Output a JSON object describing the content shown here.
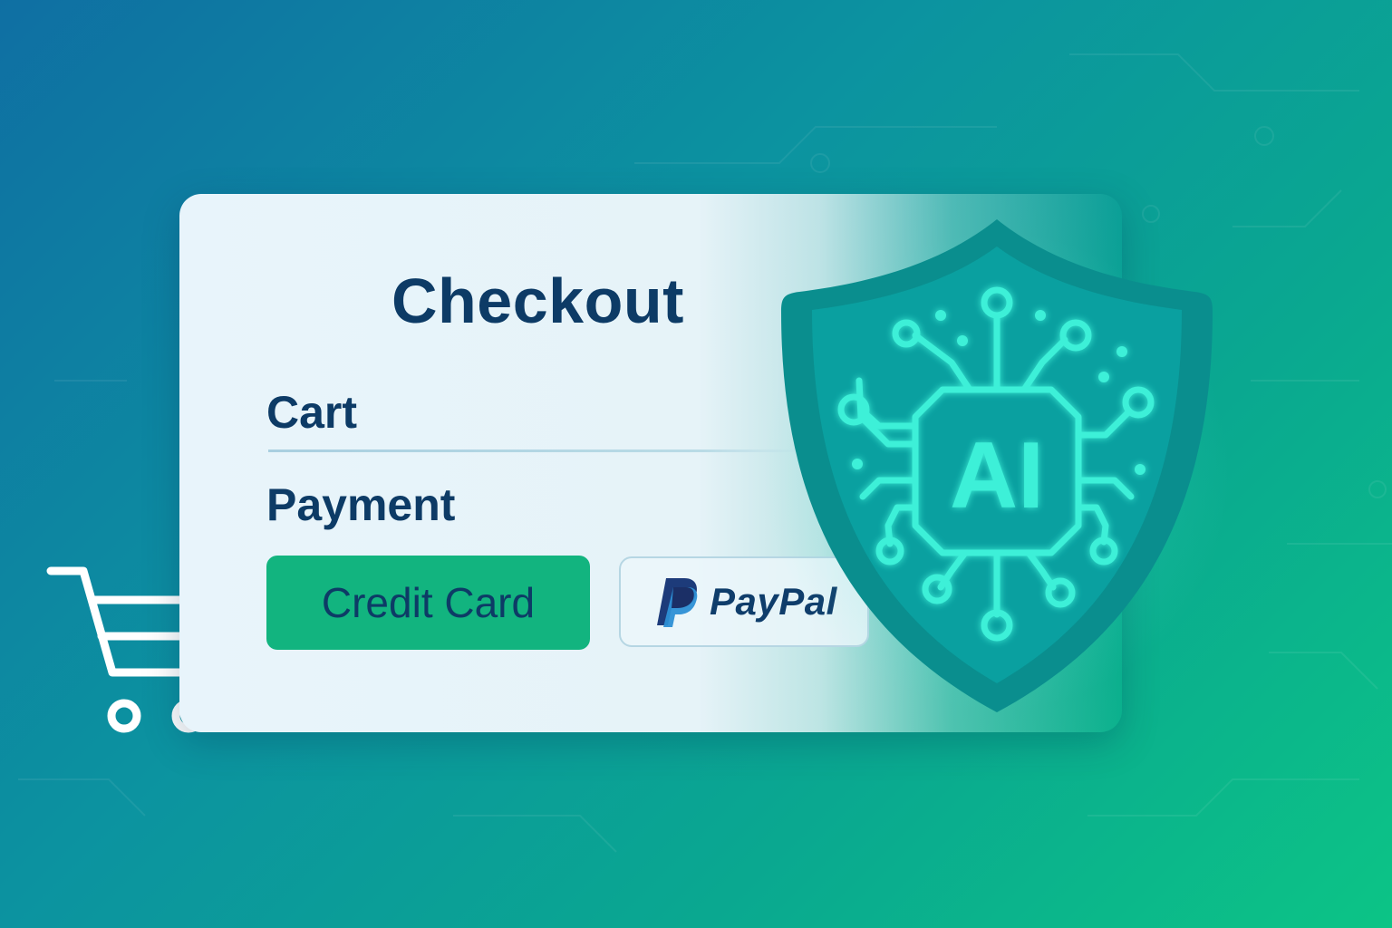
{
  "checkout": {
    "title": "Checkout",
    "cart_label": "Cart",
    "payment_label": "Payment",
    "payment_methods": {
      "credit_card_label": "Credit Card",
      "paypal_label": "PayPal"
    }
  },
  "badge": {
    "text": "AI",
    "icon": "ai-shield-icon"
  },
  "icons": {
    "cart": "shopping-cart-icon",
    "paypal": "paypal-logo-icon"
  },
  "colors": {
    "accent_green": "#12b47f",
    "title_navy": "#0d3b66",
    "circuit_cyan": "#3ef0d8",
    "shield_teal": "#0a8e8e"
  }
}
